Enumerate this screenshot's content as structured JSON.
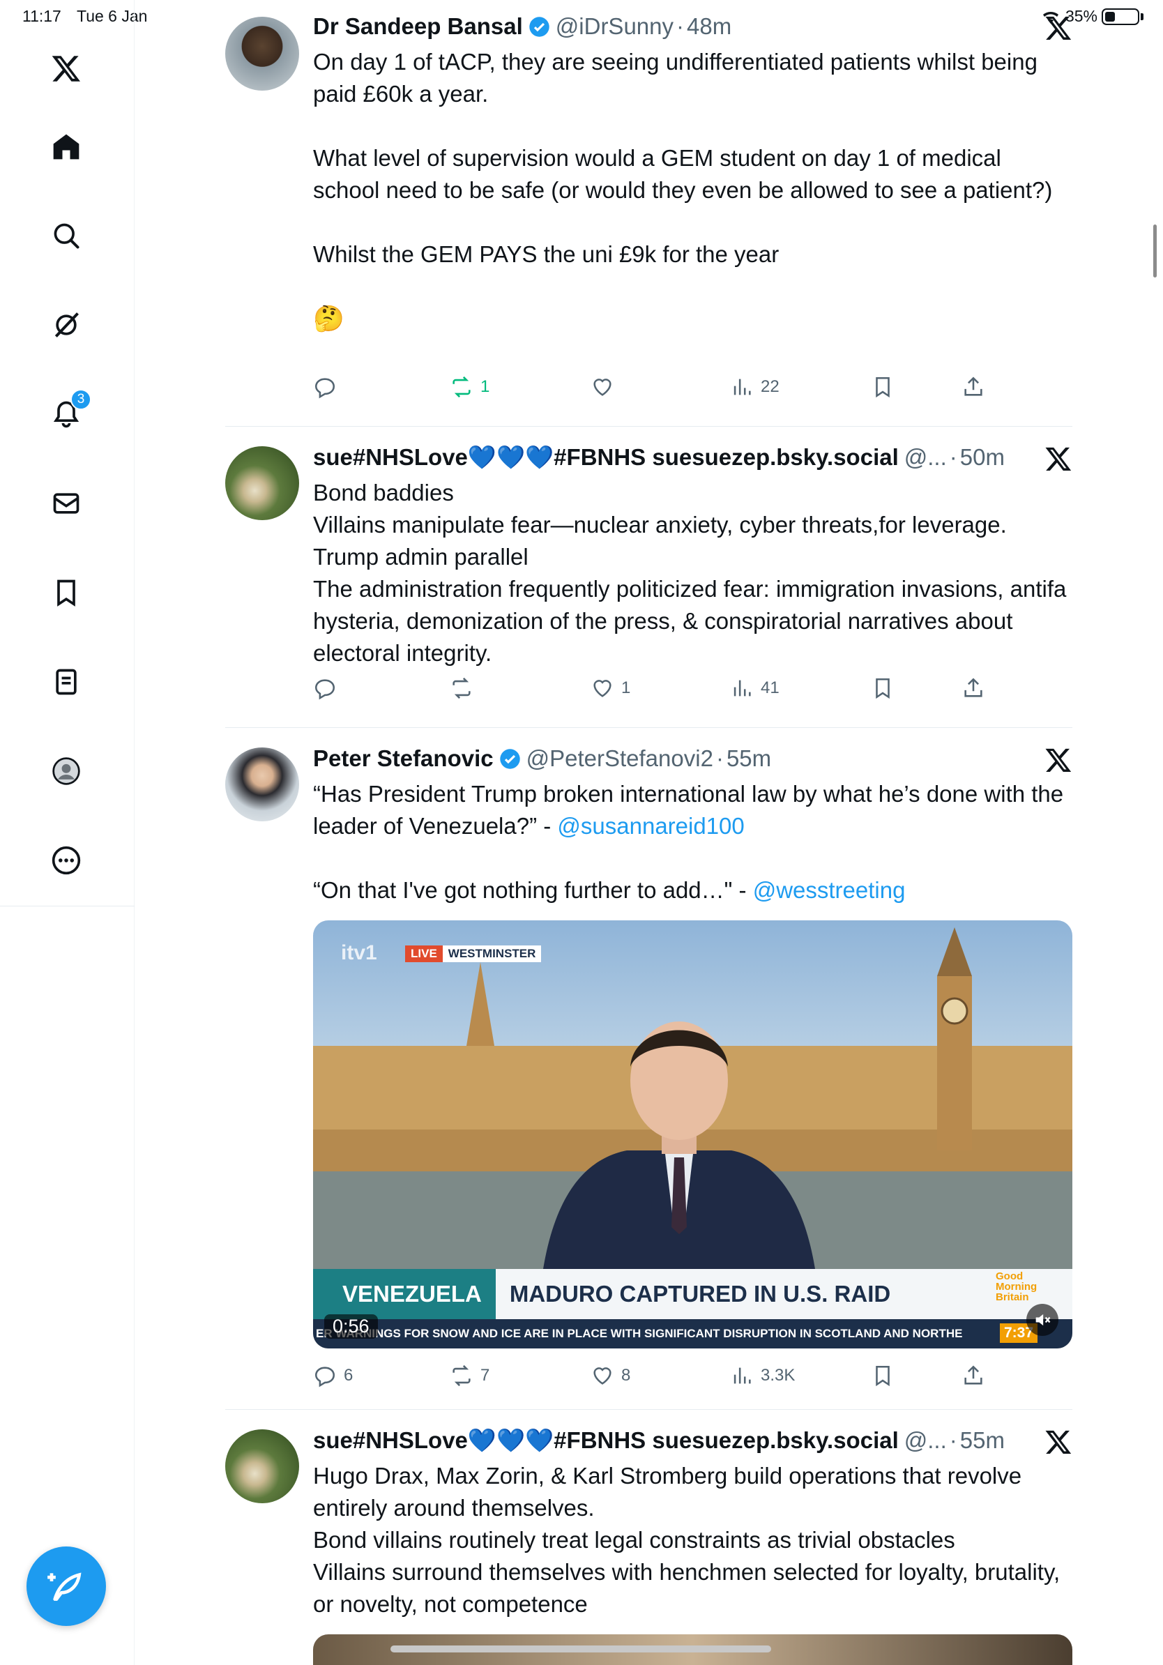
{
  "status_bar": {
    "time": "11:17",
    "date": "Tue 6 Jan",
    "battery": "35%"
  },
  "sidebar": {
    "items": [
      {
        "name": "logo",
        "icon": "x-logo-icon"
      },
      {
        "name": "home",
        "icon": "home-icon"
      },
      {
        "name": "explore",
        "icon": "search-icon"
      },
      {
        "name": "grok",
        "icon": "grok-icon"
      },
      {
        "name": "notifications",
        "icon": "bell-icon",
        "badge": "3"
      },
      {
        "name": "messages",
        "icon": "mail-icon"
      },
      {
        "name": "bookmarks",
        "icon": "bookmark-icon"
      },
      {
        "name": "lists",
        "icon": "list-icon"
      },
      {
        "name": "profile",
        "icon": "profile-icon"
      },
      {
        "name": "more",
        "icon": "more-icon"
      }
    ],
    "compose_icon": "compose-icon"
  },
  "tweets": [
    {
      "name": "Dr Sandeep Bansal",
      "verified": true,
      "handle": "@iDrSunny",
      "time": "48m",
      "paragraphs": [
        "On day 1 of tACP, they are seeing undifferentiated patients whilst being paid £60k a year.",
        "What level of supervision would a GEM student on day 1 of medical school need to be safe (or would they even be allowed to see a patient?)",
        "Whilst the GEM PAYS the uni £9k for the year",
        "🤔"
      ],
      "replies": "",
      "reposts": "1",
      "likes": "",
      "views": "22"
    },
    {
      "name": "sue#NHSLove💙💙💙#FBNHS suesuezep.bsky.social",
      "verified": false,
      "handle": "@...",
      "time": "50m",
      "paragraphs": [
        "Bond baddies\nVillains manipulate fear—nuclear anxiety, cyber threats,for leverage.\nTrump admin parallel\nThe administration frequently politicized fear: immigration invasions, antifa hysteria, demonization of the press, & conspiratorial narratives about electoral integrity."
      ],
      "replies": "",
      "reposts": "",
      "likes": "1",
      "views": "41"
    },
    {
      "name": "Peter Stefanovic",
      "verified": true,
      "handle": "@PeterStefanovi2",
      "time": "55m",
      "line1": "“Has President Trump broken international law by what he’s done with the leader of Venezuela?” - ",
      "mention1": "@susannareid100",
      "line2": "“On that I've got nothing further to add…\" - ",
      "mention2": "@wesstreeting",
      "video": {
        "channel": "itv1",
        "live": "LIVE",
        "location": "WESTMINSTER",
        "tag": "VENEZUELA",
        "headline": "MADURO CAPTURED IN U.S. RAID",
        "ticker": "ER WARNINGS FOR SNOW AND ICE ARE IN PLACE WITH SIGNIFICANT DISRUPTION IN SCOTLAND AND NORTHE",
        "show": "Good Morning Britain",
        "clock": "7:37",
        "duration": "0:56"
      },
      "replies": "6",
      "reposts": "7",
      "likes": "8",
      "views": "3.3K"
    },
    {
      "name": "sue#NHSLove💙💙💙#FBNHS suesuezep.bsky.social",
      "verified": false,
      "handle": "@...",
      "time": "55m",
      "paragraphs": [
        "Hugo Drax, Max Zorin, & Karl Stromberg build operations that revolve entirely around themselves.\nBond villains routinely treat legal constraints as trivial obstacles\nVillains surround themselves with henchmen selected for loyalty, brutality, or novelty, not competence"
      ]
    }
  ]
}
